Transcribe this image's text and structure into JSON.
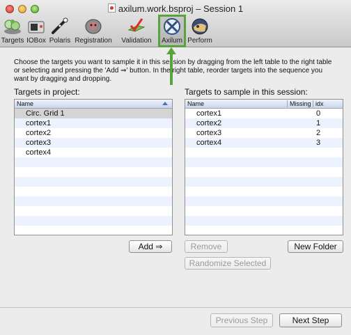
{
  "window": {
    "title": "axilum.work.bsproj – Session 1"
  },
  "toolbar": {
    "items": [
      {
        "label": "Targets",
        "icon": "targets-icon"
      },
      {
        "label": "IOBox",
        "icon": "iobox-icon"
      },
      {
        "label": "Polaris",
        "icon": "polaris-icon"
      },
      {
        "label": "Registration",
        "icon": "registration-icon"
      },
      {
        "label": "Validation",
        "icon": "validation-icon"
      },
      {
        "label": "Axilum",
        "icon": "axilum-icon",
        "selected": true
      },
      {
        "label": "Perform",
        "icon": "perform-icon"
      }
    ],
    "highlight_color": "#5aa23d"
  },
  "instructions": "Choose the targets you want to sample it in this session by dragging from the left table to the right table or selecting and pressing the 'Add ⇒' button. In the right table, reorder targets into the sequence you want by dragging and dropping.",
  "left_panel": {
    "label": "Targets in project:",
    "column": "Name",
    "rows": [
      "Circ. Grid 1",
      "cortex1",
      "cortex2",
      "cortex3",
      "cortex4"
    ],
    "add_button": "Add ⇒"
  },
  "right_panel": {
    "label": "Targets to sample in this session:",
    "columns": {
      "name": "Name",
      "missing": "Missing",
      "idx": "idx"
    },
    "rows": [
      {
        "name": "cortex1",
        "missing": "",
        "idx": "0"
      },
      {
        "name": "cortex2",
        "missing": "",
        "idx": "1"
      },
      {
        "name": "cortex3",
        "missing": "",
        "idx": "2"
      },
      {
        "name": "cortex4",
        "missing": "",
        "idx": "3"
      }
    ],
    "remove_button": "Remove",
    "new_folder_button": "New Folder",
    "randomize_button": "Randomize Selected"
  },
  "footer": {
    "previous_button": "Previous Step",
    "next_button": "Next Step"
  }
}
